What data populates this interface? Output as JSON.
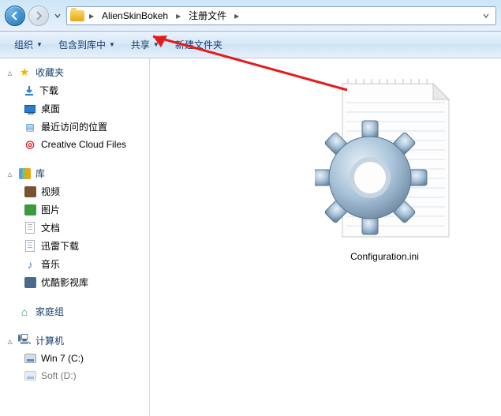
{
  "breadcrumb": {
    "item1": "AlienSkinBokeh",
    "item2": "注册文件"
  },
  "toolbar": {
    "organize": "组织",
    "include_in_library": "包含到库中",
    "share": "共享",
    "new_folder": "新建文件夹"
  },
  "sidebar": {
    "favorites": {
      "label": "收藏夹",
      "downloads": "下载",
      "desktop": "桌面",
      "recent": "最近访问的位置",
      "creative_cloud": "Creative Cloud Files"
    },
    "libraries": {
      "label": "库",
      "videos": "视频",
      "pictures": "图片",
      "documents": "文档",
      "xunlei": "迅雷下载",
      "music": "音乐",
      "youku": "优酷影视库"
    },
    "homegroup": {
      "label": "家庭组"
    },
    "computer": {
      "label": "计算机",
      "drive_c": "Win 7 (C:)",
      "drive_d": "Soft (D:)"
    }
  },
  "content": {
    "file1_name": "Configuration.ini"
  },
  "colors": {
    "accent": "#2a7dd1",
    "annotation": "#e51b1b"
  }
}
